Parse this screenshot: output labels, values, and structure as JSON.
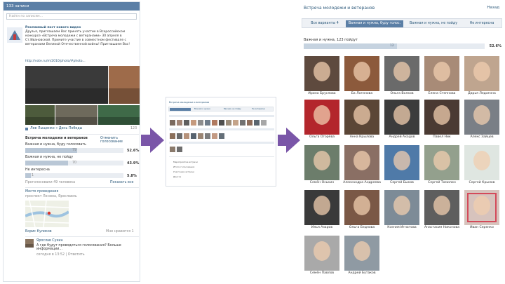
{
  "left": {
    "header": "133 записи",
    "search_placeholder": "Найти по записям...",
    "post": {
      "title": "Рекламный пост нового видео",
      "text": "Друзья, приглашаем Вас принять участие в Всероссийском конкурсе «Встреча молодежи с ветеранами» 30 апреля в Ст.Ивановской. Примите участие в совместном фестивале с ветеранами Великой Отечественной войны! Приглашаем Вас!",
      "link": "http://vote.ru/m/2010/photo/#photo..."
    },
    "likes_count": "123",
    "like_label": "Лев Лыщенко « День Победы",
    "poll": {
      "title": "Встреча молодежи и ветеранов",
      "action": "Отменить голосование",
      "options": [
        {
          "label": "Важная и нужна, буду голосовать",
          "count": "79",
          "pct": "52.6%"
        },
        {
          "label": "Важная и нужна, не пойду",
          "count": "70",
          "pct": "43.9%"
        },
        {
          "label": "Не интересна",
          "count": "1",
          "pct": "5.8%"
        }
      ],
      "voted": "Проголосовали 49 человека",
      "show_results": "Показать все"
    },
    "location_link": "Место проведения",
    "location_text": "проспект Ленина, Ярославль",
    "author": "Борис Куликов",
    "author_action": "Мне нравится 1",
    "comment": {
      "name": "Ярослав Сукин",
      "text": "А где будут проводиться голосования? Больше информации...",
      "meta": "сегодня в 13:52 | Ответить"
    }
  },
  "middle": {
    "title": "Встреча молодежи и ветеранов",
    "tabs": [
      "Все варианты",
      "Важная и нужна",
      "Важная, не пойду",
      "Не интересна"
    ],
    "rows": [
      "Мероприятие встречи",
      "Итоги голосования",
      "Участники встречи",
      "Другое"
    ],
    "footer": [
      "Рекламная страница",
      "Все комментарии"
    ]
  },
  "right": {
    "title": "Встреча молодежи и ветеранов",
    "back": "Назад",
    "tabs": [
      "Все варианты 4",
      "Важная и нужна, буду голос.",
      "Важная и нужна, не пойду",
      "Не интересна"
    ],
    "active_tab": 1,
    "vote_label": "Важная и нужна, 123 пойдут",
    "vote_count": "12",
    "vote_pct": "52.6%",
    "people": [
      {
        "name": "Ирина Бруслова"
      },
      {
        "name": "Ба Логинова"
      },
      {
        "name": "Ольга Волхов"
      },
      {
        "name": "Елена Степнова"
      },
      {
        "name": "Дарья Ледагина"
      },
      {
        "name": "Ольга Огорёва"
      },
      {
        "name": "Анна Крылова"
      },
      {
        "name": "Андрей Ахадов"
      },
      {
        "name": "Павел Ник"
      },
      {
        "name": "Алекс Зайцев"
      },
      {
        "name": "Семён Оськин"
      },
      {
        "name": "Александра Андреева"
      },
      {
        "name": "Сергей Быков"
      },
      {
        "name": "Сергей Томилин"
      },
      {
        "name": "Сергей Крылов"
      },
      {
        "name": "Илья Азаров"
      },
      {
        "name": "Ольга Беднова"
      },
      {
        "name": "Ксения Игнатова"
      },
      {
        "name": "Анастасия Никонова"
      },
      {
        "name": "Иван Серенко"
      },
      {
        "name": "Семён Павлов"
      },
      {
        "name": "Андрей Бутаков"
      }
    ]
  }
}
